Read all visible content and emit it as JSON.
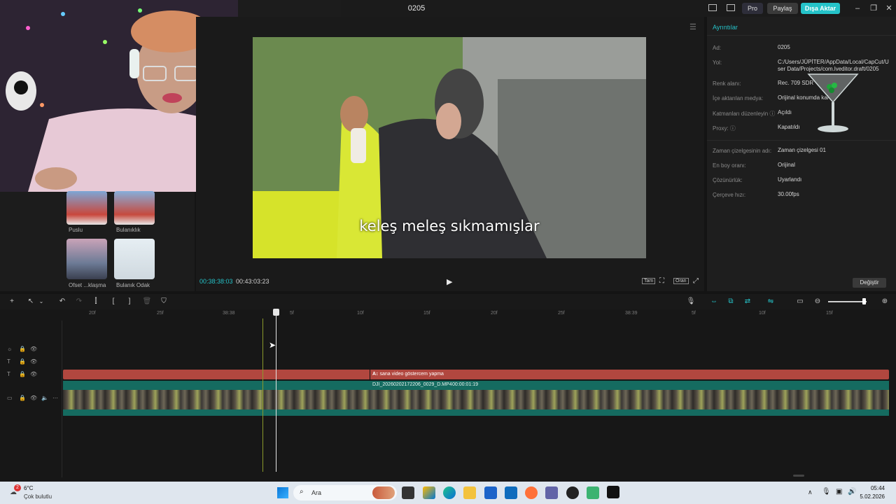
{
  "window": {
    "title": "0205",
    "pro_label": "Pro",
    "share_label": "Paylaş",
    "export_label": "Dışa Aktar"
  },
  "media_panel": {
    "items": [
      {
        "label": "Puslu"
      },
      {
        "label": "Bulanıklık"
      },
      {
        "label": "Ofset ...klaşma"
      },
      {
        "label": "Bulanık Odak"
      }
    ]
  },
  "player": {
    "subtitle": "keleş meleş sıkmamışlar",
    "current_time": "00:38:38:03",
    "total_time": "00:43:03:23",
    "full_label": "Tam",
    "ratio_label": "Oran"
  },
  "details": {
    "header": "Ayrıntılar",
    "rows": [
      {
        "label": "Ad:",
        "value": "0205"
      },
      {
        "label": "Yol:",
        "value": "C:/Users/JÜPİTER/AppData/Local/CapCut/User Data/Projects/com.lveditor.draft/0205"
      },
      {
        "label": "Renk alanı:",
        "value": "Rec. 709 SDR"
      },
      {
        "label": "İçe aktarılan medya:",
        "value": "Orijinal konumda kal"
      },
      {
        "label": "Katmanları düzenleyin ⓘ",
        "value": "Açıldı"
      },
      {
        "label": "Proxy: ⓘ",
        "value": "Kapatıldı"
      },
      {
        "label": "Zaman çizelgesinin adı:",
        "value": "Zaman çizelgesi 01"
      },
      {
        "label": "En boy oranı:",
        "value": "Orijinal"
      },
      {
        "label": "Çözünürlük:",
        "value": "Uyarlandı"
      },
      {
        "label": "Çerçeve hızı:",
        "value": "30.00fps"
      }
    ],
    "change_label": "Değiştir"
  },
  "timeline": {
    "ruler": [
      "20f",
      "25f",
      "38:38",
      "5f",
      "10f",
      "15f",
      "20f",
      "25f",
      "38:39",
      "5f",
      "10f",
      "15f"
    ],
    "text_clip": "sana video göstercem yapma",
    "video_clip_name": "DJI_20260202172206_0029_D.MP4",
    "video_clip_duration": "00:00:01:19"
  },
  "taskbar": {
    "weather_temp": "6°C",
    "weather_desc": "Çok bulutlu",
    "weather_badge": "2",
    "search_placeholder": "Ara",
    "time": "05:44",
    "date": "5.02.2026"
  }
}
